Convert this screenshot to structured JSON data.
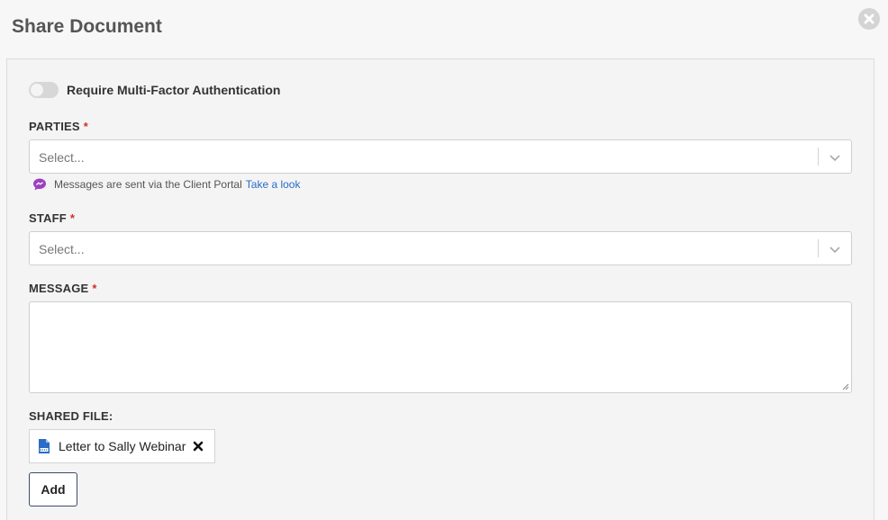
{
  "modal": {
    "title": "Share Document"
  },
  "mfa": {
    "label": "Require Multi-Factor Authentication",
    "enabled": false
  },
  "parties": {
    "label": "PARTIES",
    "required_mark": "*",
    "placeholder": "Select..."
  },
  "hint": {
    "text": "Messages are sent via the Client Portal",
    "link": "Take a look",
    "icon": "message-bubble-icon",
    "color": "#9c3fc4"
  },
  "staff": {
    "label": "STAFF",
    "required_mark": "*",
    "placeholder": "Select..."
  },
  "message": {
    "label": "MESSAGE",
    "required_mark": "*",
    "value": ""
  },
  "shared_file": {
    "label": "SHARED FILE:",
    "file_name": "Letter to Sally Webinar",
    "icon": "doc-file-icon",
    "icon_color": "#2a6cc7"
  },
  "actions": {
    "add_label": "Add"
  }
}
